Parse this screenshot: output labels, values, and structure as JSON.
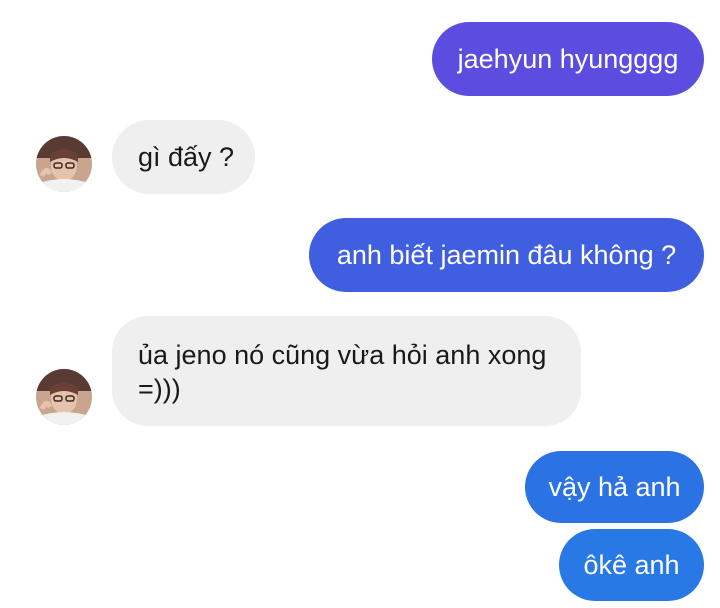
{
  "conversation": {
    "messages": [
      {
        "sender": "me",
        "text": "jaehyun hyungggg",
        "color": "#5b4de0"
      },
      {
        "sender": "contact",
        "text": "gì đấy ?"
      },
      {
        "sender": "me",
        "text": "anh biết jaemin đâu không ?",
        "color": "#3f5fe0"
      },
      {
        "sender": "contact",
        "text": "ủa jeno nó cũng vừa hỏi anh xong =)))"
      },
      {
        "sender": "me",
        "text": "vậy hả anh",
        "color": "#2b72e4"
      },
      {
        "sender": "me",
        "text": "ôkê anh",
        "color": "#2878e6"
      }
    ],
    "contact_avatar": "contact-avatar-photo",
    "colors": {
      "incoming_bubble": "#efefef",
      "incoming_text": "#1a1a1a",
      "outgoing_text": "#ffffff"
    }
  }
}
